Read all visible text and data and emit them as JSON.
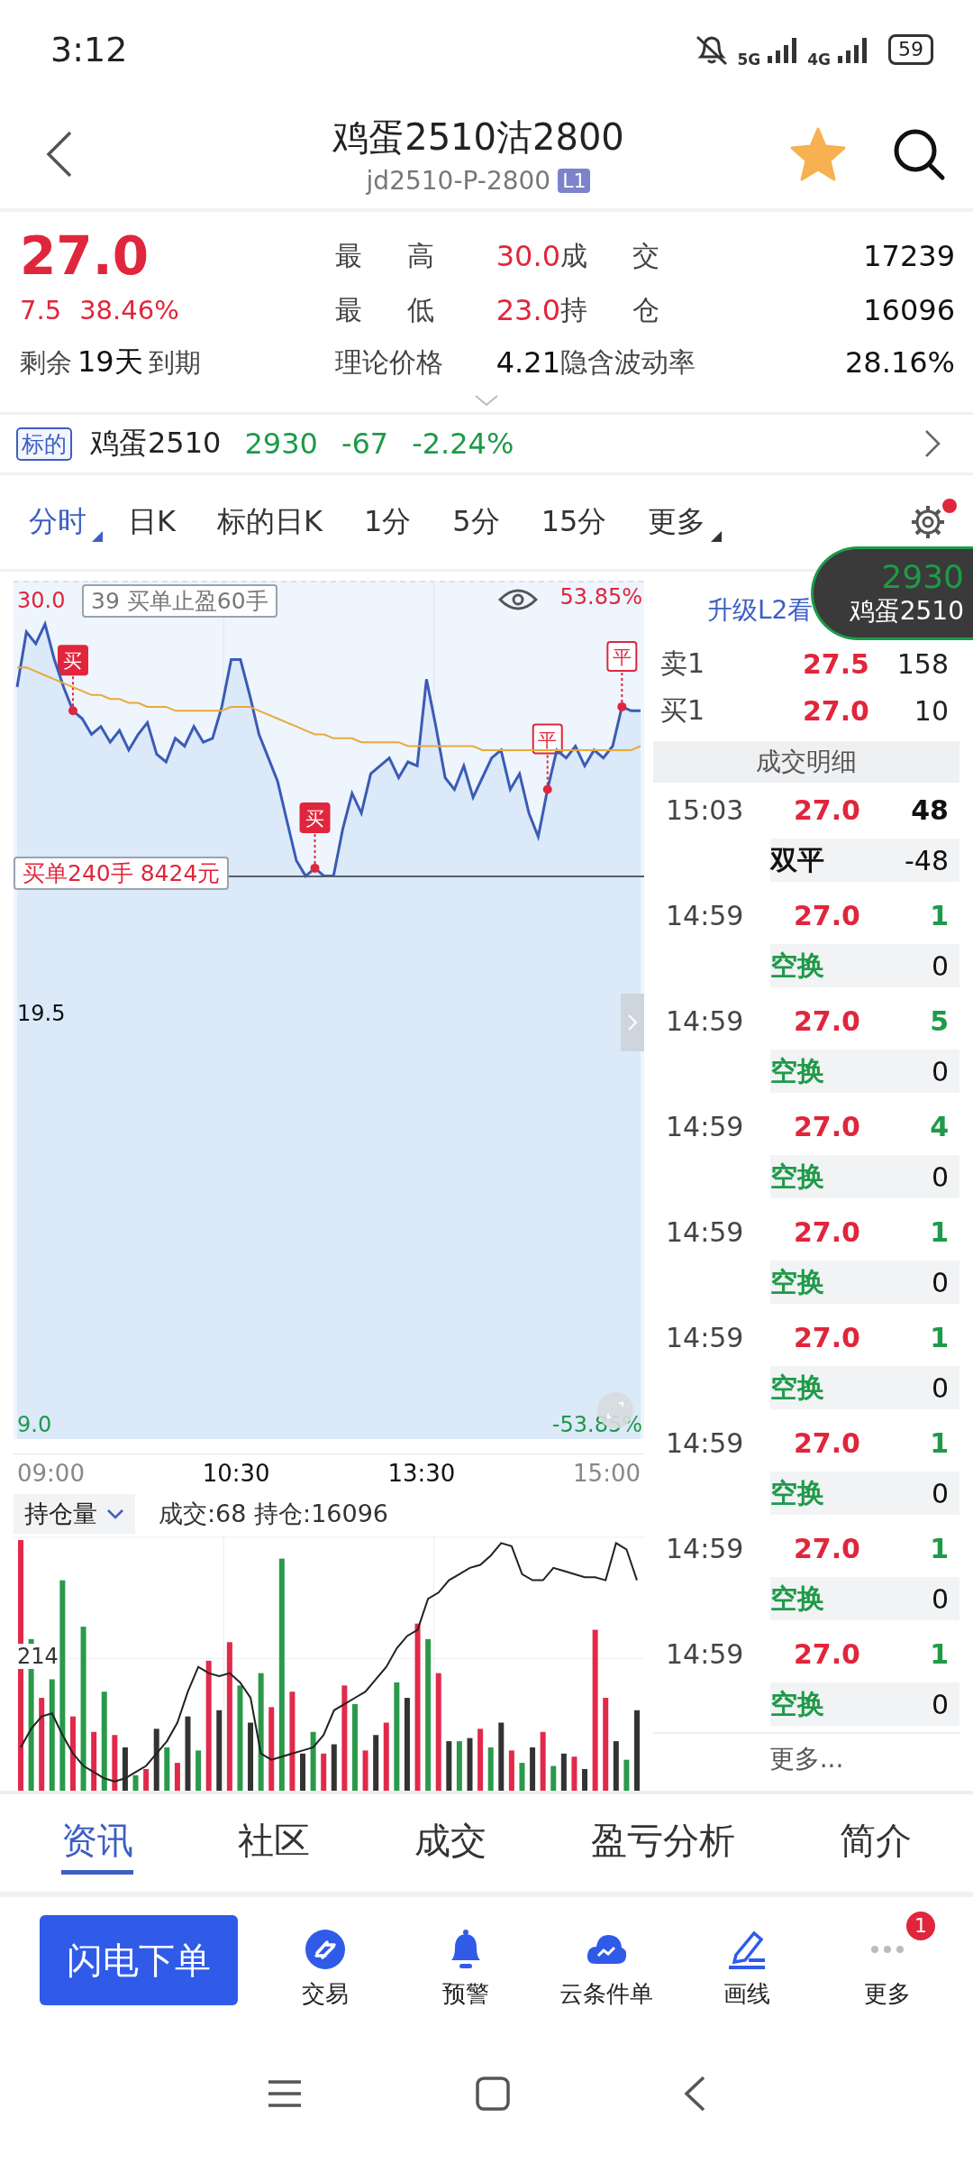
{
  "status_bar": {
    "time": "3:12",
    "network_1": "5G",
    "network_2": "4G",
    "battery": "59"
  },
  "header": {
    "title": "鸡蛋2510沽2800",
    "code": "jd2510-P-2800",
    "level_badge": "L1",
    "favorited": true
  },
  "quote": {
    "price": "27.0",
    "change": "7.5",
    "change_pct": "38.46%",
    "expiry": {
      "prefix": "剩余",
      "days": "19天",
      "suffix": "到期"
    },
    "stats": [
      {
        "label": "最 高",
        "value": "30.0",
        "color": "#e0263c"
      },
      {
        "label": "成 交",
        "value": "17239",
        "color": "#111111"
      },
      {
        "label": "最 低",
        "value": "23.0",
        "color": "#e0263c"
      },
      {
        "label": "持 仓",
        "value": "16096",
        "color": "#111111"
      },
      {
        "label": "理论价格",
        "value": "4.21",
        "color": "#111111"
      },
      {
        "label": "隐含波动率",
        "value": "28.16%",
        "color": "#111111"
      }
    ]
  },
  "underlying": {
    "tag": "标的",
    "name": "鸡蛋2510",
    "price": "2930",
    "change": "-67",
    "change_pct": "-2.24%"
  },
  "chart_tabs": [
    {
      "label": "分时",
      "selected": true,
      "dropdown": true
    },
    {
      "label": "日K",
      "selected": false,
      "dropdown": false
    },
    {
      "label": "标的日K",
      "selected": false,
      "dropdown": false
    },
    {
      "label": "1分",
      "selected": false,
      "dropdown": false
    },
    {
      "label": "5分",
      "selected": false,
      "dropdown": false
    },
    {
      "label": "15分",
      "selected": false,
      "dropdown": false
    },
    {
      "label": "更多",
      "selected": false,
      "dropdown": true
    }
  ],
  "settings_notification": true,
  "price_chart": {
    "pct_high": "53.85%",
    "pct_low": "-53.85%",
    "order_tags": [
      {
        "text": "39 买单止盈60手",
        "color": "#777777"
      },
      {
        "text": "买单240手 8424元",
        "color": "#e0263c"
      }
    ],
    "markers": [
      {
        "label": "买",
        "filled": true
      },
      {
        "label": "买",
        "filled": true
      },
      {
        "label": "平",
        "filled": false
      },
      {
        "label": "平",
        "filled": false
      }
    ],
    "chart_data": {
      "type": "line",
      "ylim": [
        8.7,
        30
      ],
      "yticks": [
        {
          "value": 30,
          "label": "30.0"
        },
        {
          "value": 19.5,
          "label": "19.5"
        },
        {
          "value": 9,
          "label": "9.0"
        }
      ],
      "series": [
        {
          "color": "#3b5bb5",
          "values": [
            27.8,
            29.2,
            28.9,
            29.4,
            28.5,
            27.8,
            27.2,
            27.0,
            26.6,
            26.8,
            26.4,
            26.7,
            26.2,
            26.6,
            26.9,
            26.1,
            25.9,
            26.5,
            26.3,
            26.8,
            26.4,
            26.5,
            27.3,
            28.5,
            28.5,
            27.6,
            26.6,
            26.0,
            25.4,
            24.4,
            23.4,
            23.0,
            23.2,
            23.0,
            23.0,
            24.2,
            25.1,
            24.6,
            25.6,
            25.8,
            26.0,
            25.5,
            25.9,
            25.8,
            28.0,
            26.8,
            25.5,
            25.2,
            25.8,
            25.0,
            25.5,
            26.0,
            26.2,
            25.2,
            25.6,
            24.6,
            24.0,
            25.2,
            26.2,
            26.0,
            26.3,
            25.8,
            26.2,
            26.0,
            26.3,
            27.3,
            27.2,
            27.2
          ]
        },
        {
          "color": "#e8a93a",
          "values": [
            28.3,
            28.3,
            28.2,
            28.1,
            28.0,
            27.9,
            27.8,
            27.7,
            27.6,
            27.6,
            27.5,
            27.5,
            27.4,
            27.4,
            27.3,
            27.3,
            27.3,
            27.2,
            27.2,
            27.2,
            27.2,
            27.2,
            27.2,
            27.3,
            27.3,
            27.3,
            27.2,
            27.1,
            27.0,
            26.9,
            26.8,
            26.7,
            26.6,
            26.6,
            26.5,
            26.5,
            26.5,
            26.4,
            26.4,
            26.4,
            26.4,
            26.4,
            26.3,
            26.3,
            26.3,
            26.3,
            26.3,
            26.3,
            26.3,
            26.3,
            26.2,
            26.2,
            26.2,
            26.2,
            26.2,
            26.2,
            26.2,
            26.2,
            26.2,
            26.2,
            26.2,
            26.2,
            26.2,
            26.2,
            26.2,
            26.2,
            26.2,
            26.3
          ]
        }
      ]
    }
  },
  "time_labels": [
    "09:00",
    "10:30",
    "13:30",
    "15:00"
  ],
  "volume_chart": {
    "selector": "持仓量",
    "summary": "成交:68 持仓:16096",
    "scale_label": "214"
  },
  "floating_badge": {
    "price": "2930",
    "name": "鸡蛋2510"
  },
  "depth": {
    "upgrade_link": "升级L2看",
    "levels": [
      {
        "label": "卖1",
        "price": "27.5",
        "volume": "158"
      },
      {
        "label": "买1",
        "price": "27.0",
        "volume": "10"
      }
    ]
  },
  "trades": {
    "title": "成交明细",
    "more": "更多...",
    "rows": [
      {
        "time": "15:03",
        "price": "27.0",
        "volume": "48",
        "action": "双平",
        "action_volume": "-48",
        "color": "#111111"
      },
      {
        "time": "14:59",
        "price": "27.0",
        "volume": "1",
        "action": "空换",
        "action_volume": "0",
        "color": "#1e9a48"
      },
      {
        "time": "14:59",
        "price": "27.0",
        "volume": "5",
        "action": "空换",
        "action_volume": "0",
        "color": "#1e9a48"
      },
      {
        "time": "14:59",
        "price": "27.0",
        "volume": "4",
        "action": "空换",
        "action_volume": "0",
        "color": "#1e9a48"
      },
      {
        "time": "14:59",
        "price": "27.0",
        "volume": "1",
        "action": "空换",
        "action_volume": "0",
        "color": "#1e9a48"
      },
      {
        "time": "14:59",
        "price": "27.0",
        "volume": "1",
        "action": "空换",
        "action_volume": "0",
        "color": "#1e9a48"
      },
      {
        "time": "14:59",
        "price": "27.0",
        "volume": "1",
        "action": "空换",
        "action_volume": "0",
        "color": "#1e9a48"
      },
      {
        "time": "14:59",
        "price": "27.0",
        "volume": "1",
        "action": "空换",
        "action_volume": "0",
        "color": "#1e9a48"
      },
      {
        "time": "14:59",
        "price": "27.0",
        "volume": "1",
        "action": "空换",
        "action_volume": "0",
        "color": "#1e9a48"
      }
    ]
  },
  "info_tabs": [
    {
      "label": "资讯",
      "selected": true
    },
    {
      "label": "社区",
      "selected": false
    },
    {
      "label": "成交",
      "selected": false
    },
    {
      "label": "盈亏分析",
      "selected": false
    },
    {
      "label": "简介",
      "selected": false
    }
  ],
  "action_bar": {
    "primary": "闪电下单",
    "items": [
      {
        "label": "交易",
        "kind": "trade"
      },
      {
        "label": "预警",
        "kind": "alert"
      },
      {
        "label": "云条件单",
        "kind": "cloud"
      },
      {
        "label": "画线",
        "kind": "draw"
      },
      {
        "label": "更多",
        "kind": "more",
        "badge": "1"
      }
    ]
  }
}
